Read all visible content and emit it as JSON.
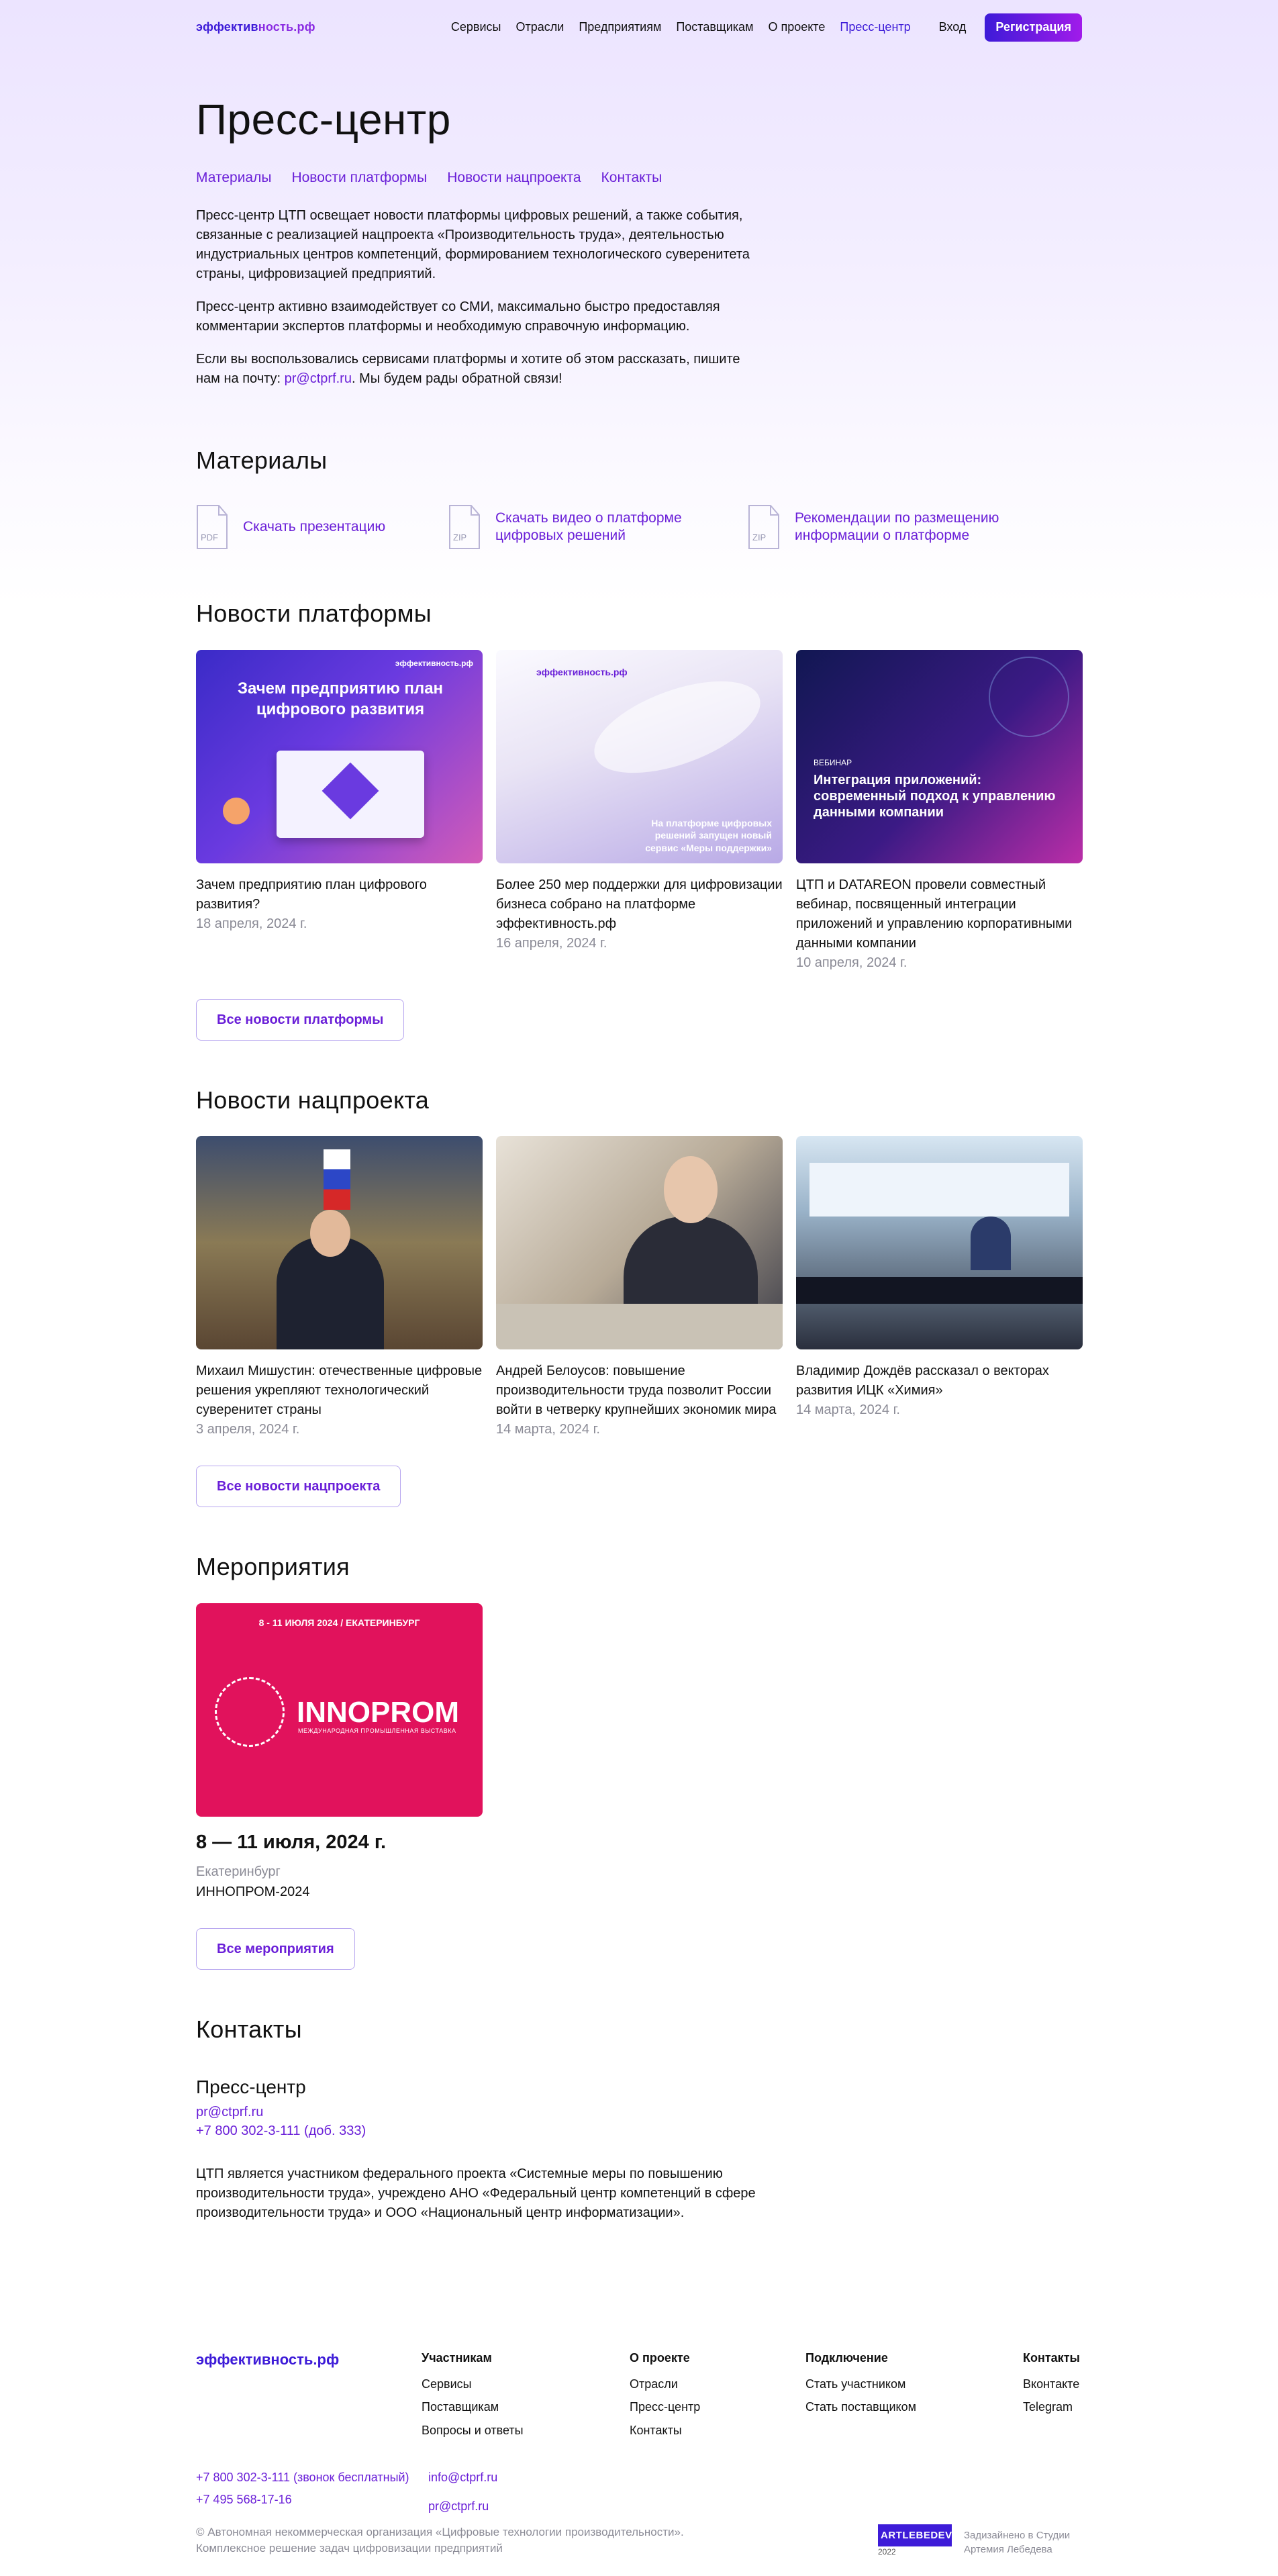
{
  "header": {
    "logo_a": "эффектив",
    "logo_b": "ность.рф",
    "nav": [
      "Сервисы",
      "Отрасли",
      "Предприятиям",
      "Поставщикам",
      "О проекте",
      "Пресс-центр"
    ],
    "login": "Вход",
    "register": "Регистрация"
  },
  "page_title": "Пресс-центр",
  "subnav": [
    "Материалы",
    "Новости платформы",
    "Новости нацпроекта",
    "Контакты"
  ],
  "intro": {
    "p1": "Пресс-центр ЦТП освещает новости платформы цифровых решений, а также события, связанные с реализацией нацпроекта «Производительность труда», деятельностью индустриальных центров компетенций, формированием технологического суверенитета страны, цифровизацией предприятий.",
    "p2": "Пресс-центр активно взаимодействует со СМИ, максимально быстро предоставляя комментарии экспертов платформы и необходимую справочную информацию.",
    "p3_a": "Если вы воспользовались сервисами платформы и хотите об этом рассказать, пишите нам на почту: ",
    "p3_email": "pr@ctprf.ru",
    "p3_b": ". Мы будем рады обратной связи!"
  },
  "materials": {
    "heading": "Материалы",
    "items": [
      {
        "type": "PDF",
        "label": "Скачать презентацию"
      },
      {
        "type": "ZIP",
        "label": "Скачать видео о платформе цифровых решений"
      },
      {
        "type": "ZIP",
        "label": "Рекомендации по размещению информации о платформе"
      }
    ]
  },
  "platform_news": {
    "heading": "Новости платформы",
    "items": [
      {
        "title": "Зачем предприятию план цифрового развития?",
        "date": "18 апреля, 2024 г.",
        "overlay": "Зачем предприятию план цифрового развития",
        "tag": "эффективность.рф"
      },
      {
        "title": "Более 250 мер поддержки для цифровизации бизнеса собрано на платформе эффективность.рф",
        "date": "16 апреля, 2024 г.",
        "overlay": "На платформе цифровых решений запущен новый сервис «Меры поддержки»",
        "tag": "эффективность.рф"
      },
      {
        "title": "ЦТП и DATAREON провели совместный вебинар, посвященный интеграции приложений и управлению корпоративными данными компании",
        "date": "10 апреля, 2024 г.",
        "overlay": "Интеграция приложений: современный подход к управлению данными компании",
        "tag": "ВЕБИНАР"
      }
    ],
    "all": "Все новости платформы"
  },
  "national_news": {
    "heading": "Новости нацпроекта",
    "items": [
      {
        "title": "Михаил Мишустин: отечественные цифровые решения укрепляют технологический суверенитет страны",
        "date": "3 апреля, 2024 г."
      },
      {
        "title": "Андрей Белоусов: повышение производительности труда позволит России войти в четверку крупнейших экономик мира",
        "date": "14 марта, 2024 г."
      },
      {
        "title": "Владимир Дождёв рассказал о векторах развития ИЦК «Химия»",
        "date": "14 марта, 2024 г."
      }
    ],
    "all": "Все новости нацпроекта"
  },
  "events": {
    "heading": "Мероприятия",
    "banner_top": "8 - 11 ИЮЛЯ 2024 / ЕКАТЕРИНБУРГ",
    "banner_logo": "INNOPROM",
    "banner_sub": "МЕЖДУНАРОДНАЯ ПРОМЫШЛЕННАЯ ВЫСТАВКА",
    "date": "8 — 11 июля, 2024 г.",
    "city": "Екатеринбург",
    "name": "ИННОПРОМ-2024",
    "all": "Все мероприятия"
  },
  "contacts": {
    "heading": "Контакты",
    "sub": "Пресс-центр",
    "email": "pr@ctprf.ru",
    "phone": "+7 800 302-3-111 (доб. 333)",
    "note": "ЦТП является участником федерального проекта «Системные меры по повышению производительности труда», учреждено АНО «Федеральный центр компетенций в сфере производительности труда» и ООО «Национальный центр информатизации»."
  },
  "footer": {
    "logo": "эффективность.рф",
    "cols": [
      {
        "title": "Участникам",
        "items": [
          "Сервисы",
          "Поставщикам",
          "Вопросы и ответы"
        ]
      },
      {
        "title": "О проекте",
        "items": [
          "Отрасли",
          "Пресс-центр",
          "Контакты"
        ]
      },
      {
        "title": "Подключение",
        "items": [
          "Стать участником",
          "Стать поставщиком"
        ]
      },
      {
        "title": "Контакты",
        "items": [
          "Вконтакте",
          "Telegram"
        ]
      }
    ],
    "phone1": "+7 800 302-3-111 (звонок бесплатный)",
    "phone2": "+7 495 568-17-16",
    "email1": "info@ctprf.ru",
    "email2": "pr@ctprf.ru",
    "copyright1": "© Автономная некоммерческая организация «Цифровые технологии производительности».",
    "copyright2": "Комплексное решение задач цифровизации предприятий",
    "studio_badge": "ARTLEBEDEV",
    "studio_year": "2022",
    "studio1": "Задизайнено в Студии",
    "studio2": "Артемия Лебедева"
  }
}
